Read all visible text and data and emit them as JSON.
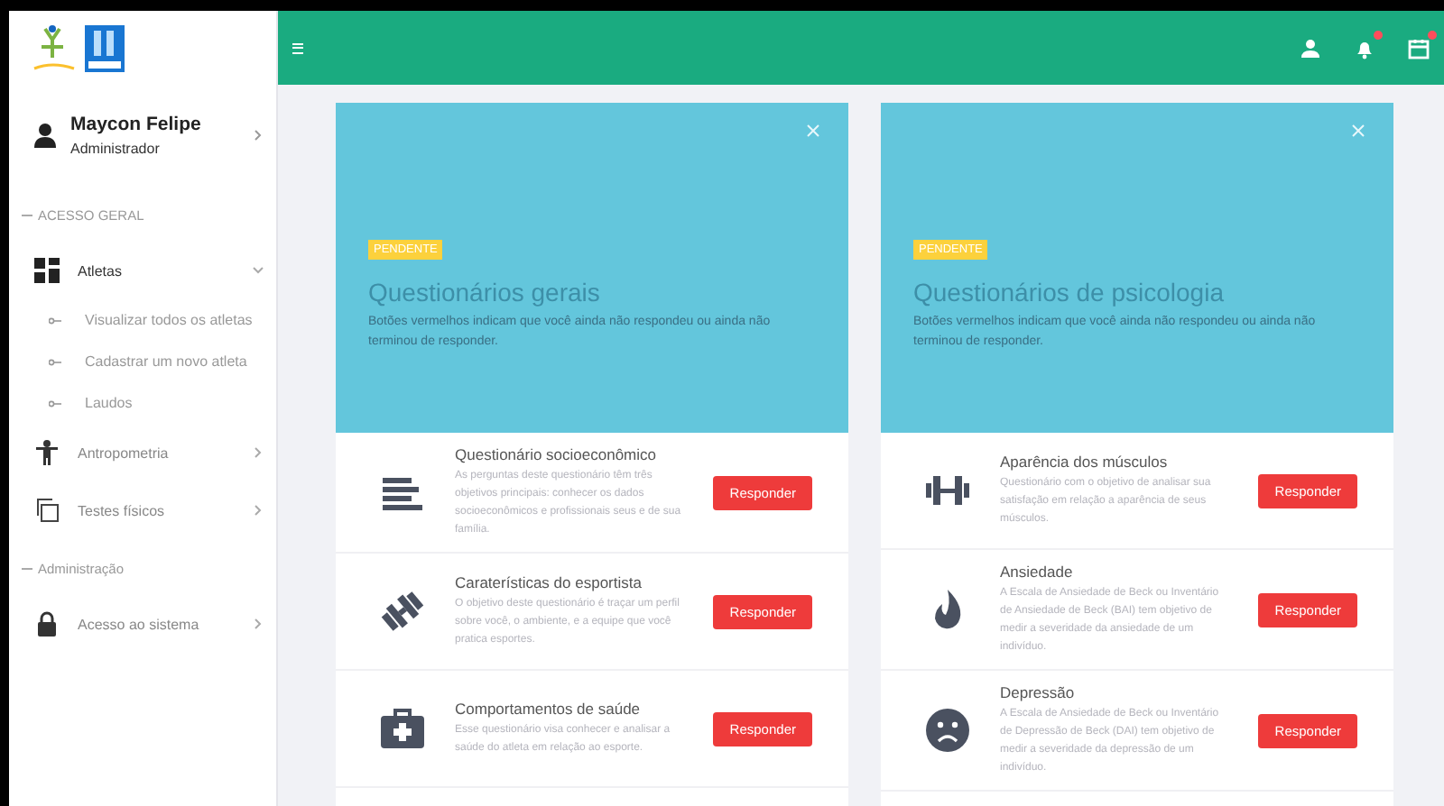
{
  "user": {
    "name": "Maycon Felipe",
    "role": "Administrador"
  },
  "sidebar": [
    {
      "kind": "section",
      "label": "ACESSO GERAL"
    },
    {
      "kind": "grid",
      "label": "Atletas",
      "expanded": true,
      "children": [
        {
          "label": "Visualizar todos os atletas"
        },
        {
          "label": "Cadastrar um novo atleta"
        },
        {
          "label": "Laudos"
        }
      ]
    },
    {
      "kind": "figure",
      "label": "Antropometria",
      "expanded": false
    },
    {
      "kind": "copy",
      "label": "Testes físicos",
      "expanded": false
    },
    {
      "kind": "section",
      "label": "Administração"
    },
    {
      "kind": "lock",
      "label": "Acesso ao sistema",
      "expanded": false
    }
  ],
  "topbar": {
    "icons": [
      {
        "kind": "user",
        "alert": false
      },
      {
        "kind": "bell",
        "alert": true
      },
      {
        "kind": "calendar",
        "alert": true
      }
    ]
  },
  "cards": [
    {
      "badge": "PENDENTE",
      "title": "Questionários gerais",
      "subtitle": "Botões vermelhos indicam que você ainda não respondeu ou ainda não terminou de responder.",
      "items": [
        {
          "kind": "list",
          "title": "Questionário socioeconômico",
          "text": "As perguntas deste questionário têm três objetivos principais: conhecer os dados socioeconômicos e profissionais seus e de sua família.",
          "button": "Responder"
        },
        {
          "kind": "dumbbell",
          "title": "Caraterísticas do esportista",
          "text": "O objetivo deste questionário é traçar um perfil sobre você, o ambiente, e a equipe que você pratica esportes.",
          "button": "Responder"
        },
        {
          "kind": "medkit",
          "title": "Comportamentos de saúde",
          "text": "Esse questionário visa conhecer e analisar a saúde do atleta em relação ao esporte.",
          "button": "Responder"
        }
      ]
    },
    {
      "badge": "PENDENTE",
      "title": "Questionários de psicologia",
      "subtitle": "Botões vermelhos indicam que você ainda não respondeu ou ainda não terminou de responder.",
      "items": [
        {
          "kind": "weights",
          "title": "Aparência dos músculos",
          "text": "Questionário com o objetivo de analisar sua satisfação em relação a aparência de seus músculos.",
          "button": "Responder"
        },
        {
          "kind": "flame",
          "title": "Ansiedade",
          "text": "A Escala de Ansiedade de Beck ou Inventário de Ansiedade de Beck (BAI) tem objetivo de medir a severidade da ansiedade de um indivíduo.",
          "button": "Responder"
        },
        {
          "kind": "sad",
          "title": "Depressão",
          "text": "A Escala de Ansiedade de Beck ou Inventário de Depressão de Beck (DAI) tem objetivo de medir a severidade da depressão de um indivíduo.",
          "button": "Responder"
        }
      ]
    }
  ]
}
